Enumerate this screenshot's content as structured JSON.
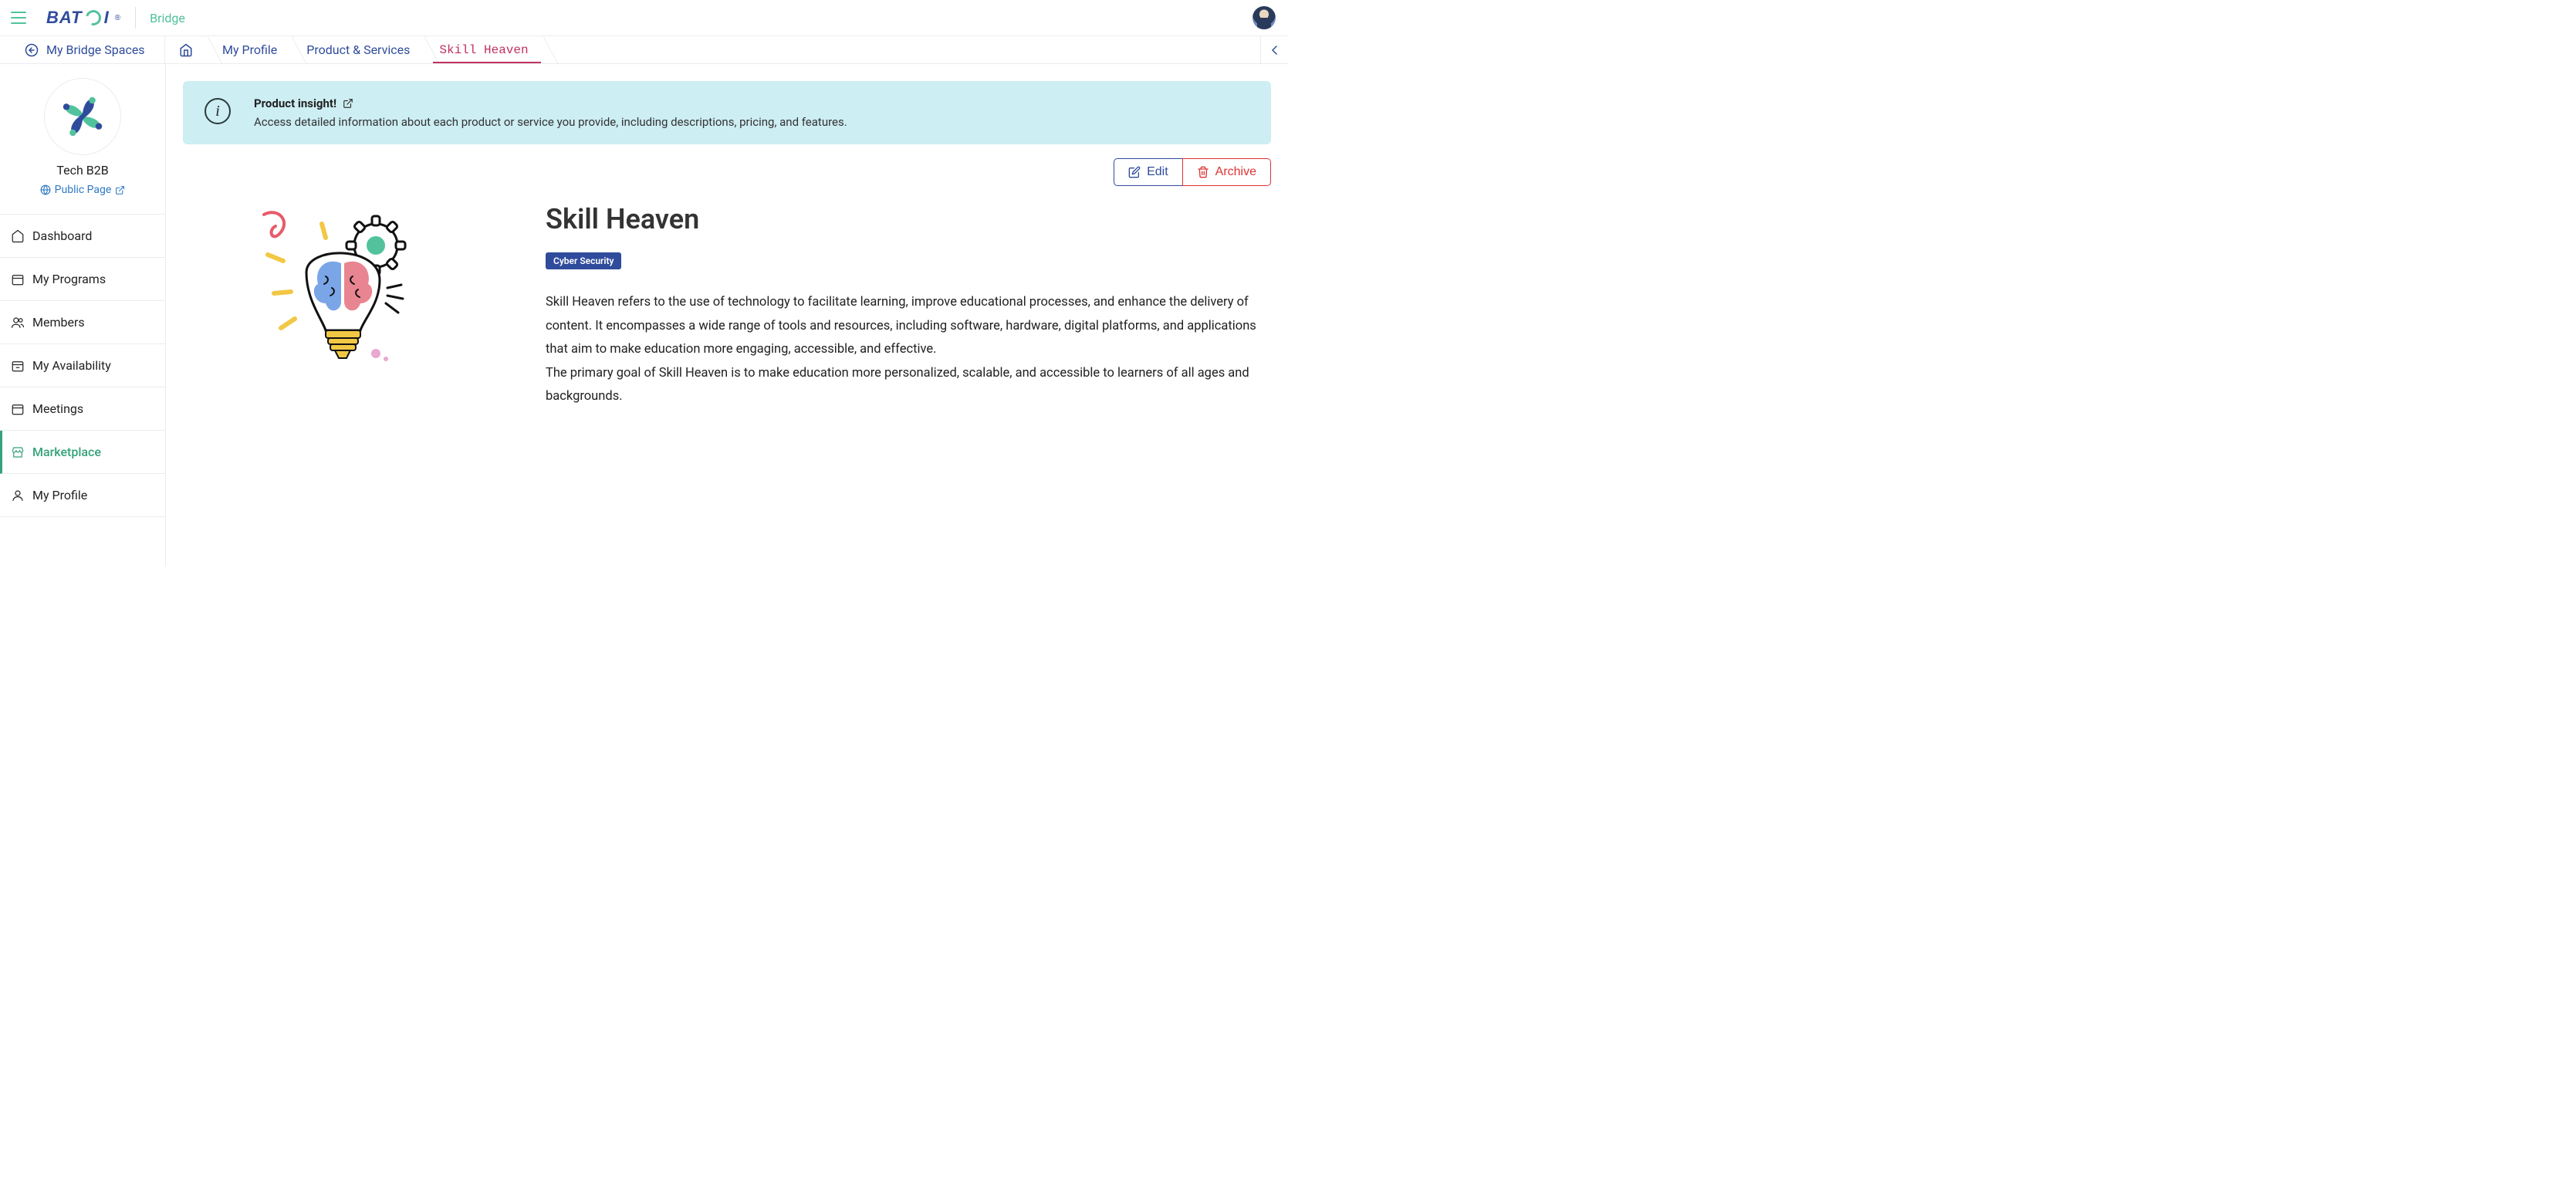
{
  "header": {
    "product_name": "Bridge",
    "logo_text_left": "BAT",
    "logo_text_right": "I",
    "logo_reg": "®"
  },
  "breadcrumb": {
    "back_label": "My Bridge Spaces",
    "items": [
      "My Profile",
      "Product & Services",
      "Skill Heaven"
    ]
  },
  "sidebar": {
    "space_name": "Tech B2B",
    "public_page_label": "Public Page",
    "nav": [
      {
        "label": "Dashboard"
      },
      {
        "label": "My Programs"
      },
      {
        "label": "Members"
      },
      {
        "label": "My Availability"
      },
      {
        "label": "Meetings"
      },
      {
        "label": "Marketplace"
      },
      {
        "label": "My Profile"
      }
    ]
  },
  "insight": {
    "title": "Product insight!",
    "desc": "Access detailed information about each product or service you provide, including descriptions, pricing, and features."
  },
  "actions": {
    "edit": "Edit",
    "archive": "Archive"
  },
  "product": {
    "title": "Skill Heaven",
    "tag": "Cyber Security",
    "paragraph1": "Skill Heaven refers to the use of technology to facilitate learning, improve educational processes, and enhance the delivery of content. It encompasses a wide range of tools and resources, including software, hardware, digital platforms, and applications that aim to make education more engaging, accessible, and effective.",
    "paragraph2": "The primary goal of Skill Heaven is to make education more personalized, scalable, and accessible to learners of all ages and backgrounds."
  }
}
